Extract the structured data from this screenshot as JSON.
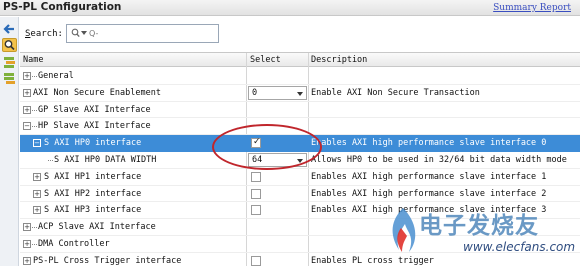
{
  "window": {
    "title": "PS-PL Configuration",
    "summary_link": "Summary Report"
  },
  "search": {
    "label_prefix": "",
    "label_underlined": "S",
    "label_suffix": "earch:",
    "placeholder": "Q-"
  },
  "columns": {
    "name": "Name",
    "select": "Select",
    "description": "Description"
  },
  "rows": [
    {
      "name": "General",
      "description": ""
    },
    {
      "name": "AXI Non Secure Enablement",
      "select_value": "0",
      "description": "Enable AXI Non Secure Transaction"
    },
    {
      "name": "GP Slave AXI Interface",
      "description": ""
    },
    {
      "name": "HP Slave AXI Interface",
      "description": ""
    },
    {
      "name": "S AXI HP0 interface",
      "checked": true,
      "description": "Enables AXI high performance slave interface 0"
    },
    {
      "name": "S AXI HP0 DATA WIDTH",
      "select_value": "64",
      "description": "Allows HP0 to be used in 32/64 bit data width mode"
    },
    {
      "name": "S AXI HP1 interface",
      "checked": false,
      "description": "Enables AXI high performance slave interface 1"
    },
    {
      "name": "S AXI HP2 interface",
      "checked": false,
      "description": "Enables AXI high performance slave interface 2"
    },
    {
      "name": "S AXI HP3 interface",
      "checked": false,
      "description": "Enables AXI high performance slave interface 3"
    },
    {
      "name": "ACP Slave AXI Interface",
      "description": ""
    },
    {
      "name": "DMA Controller",
      "description": ""
    },
    {
      "name": "PS-PL Cross Trigger interface",
      "checked": false,
      "description": "Enables PL cross trigger"
    }
  ],
  "watermark": {
    "brand": "电子发烧友",
    "url": "www.elecfans.com"
  },
  "colors": {
    "selection": "#3d8cd7",
    "annotation": "#c0262c",
    "link": "#3a4ec0"
  },
  "icons": [
    "back-arrow-icon",
    "search-icon",
    "expand-all-icon",
    "collapse-all-icon"
  ]
}
